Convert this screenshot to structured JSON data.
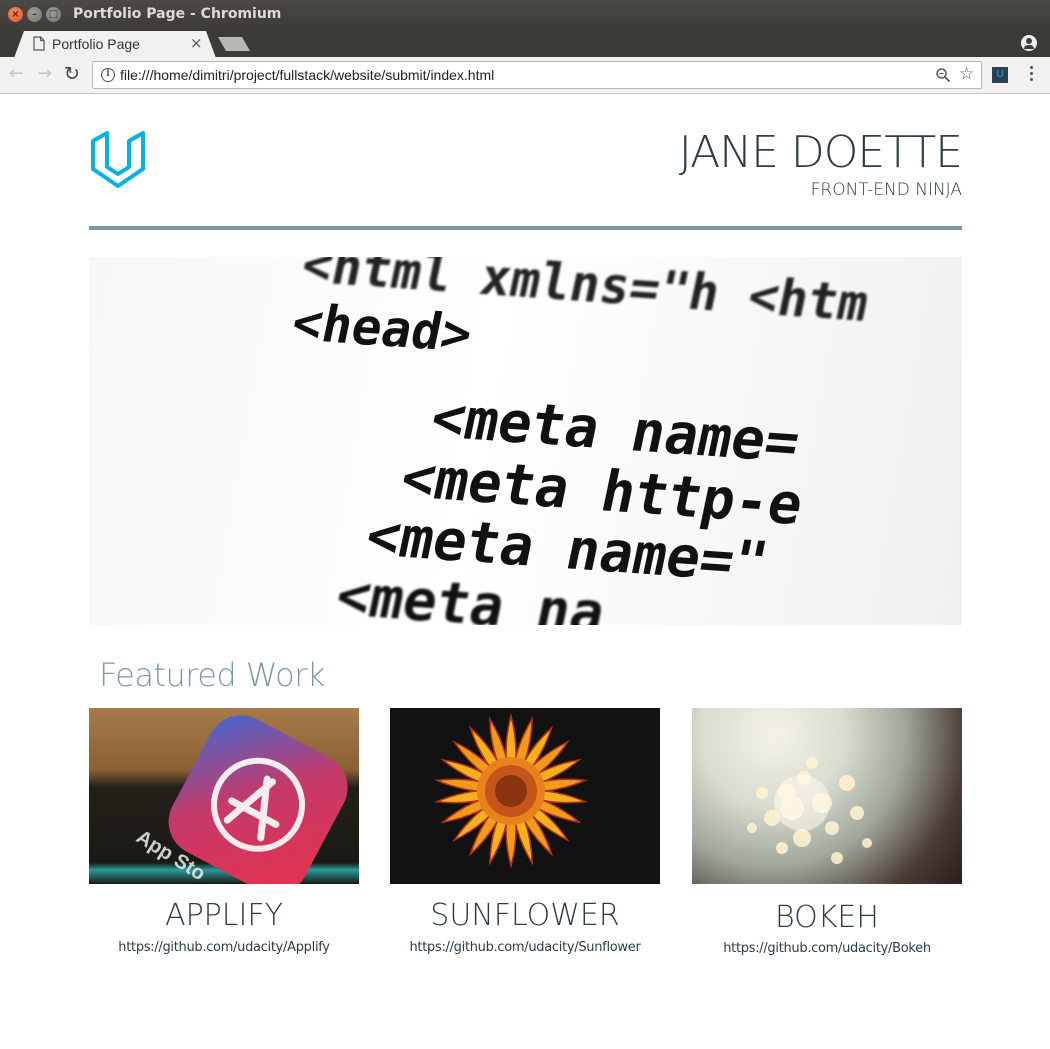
{
  "window": {
    "title": "Portfolio Page - Chromium",
    "close_glyph": "×",
    "min_glyph": "–",
    "max_glyph": "□"
  },
  "tab": {
    "title": "Portfolio Page",
    "close_glyph": "×"
  },
  "toolbar": {
    "back_glyph": "←",
    "forward_glyph": "→",
    "reload_glyph": "↻",
    "info_glyph": "i",
    "url": "file:///home/dimitri/project/fullstack/website/submit/index.html",
    "star_glyph": "☆",
    "extension_glyph": "U"
  },
  "header": {
    "name": "JANE DOETTE",
    "subtitle": "FRONT-END NINJA"
  },
  "hero": {
    "code_lines": [
      "<html  xmlns=\"h  <htm",
      "<head>",
      "<meta  name=",
      "<meta  http-e",
      "<meta  name=\"",
      "<meta  na"
    ]
  },
  "featured": {
    "heading": "Featured Work",
    "projects": [
      {
        "title": "APPLIFY",
        "link": "https://github.com/udacity/Applify",
        "image_text": "App Sto"
      },
      {
        "title": "SUNFLOWER",
        "link": "https://github.com/udacity/Sunflower"
      },
      {
        "title": "BOKEH",
        "link": "https://github.com/udacity/Bokeh"
      }
    ]
  },
  "colors": {
    "brand_blue": "#02b3e4",
    "heading_text": "#2d3c49",
    "accent_rule": "#7d97ad",
    "titlebar_bg": "#3c3b37"
  },
  "icons": {
    "logo": "udacity-logo-icon",
    "tab": "document-icon",
    "profile": "profile-icon",
    "zoom": "zoom-icon",
    "star": "star-icon",
    "menu": "menu-icon"
  }
}
